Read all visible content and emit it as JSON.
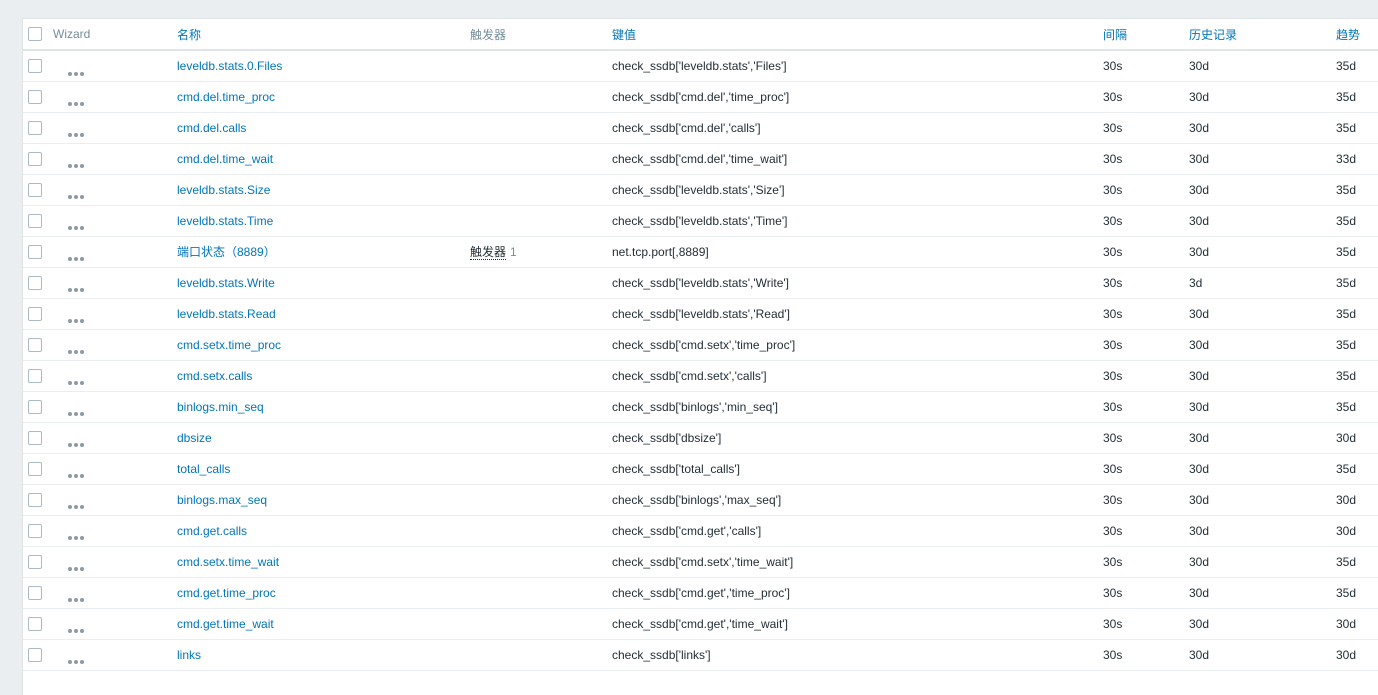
{
  "headers": {
    "wizard": "Wizard",
    "name": "名称",
    "triggers": "触发器",
    "key": "键值",
    "interval": "间隔",
    "history": "历史记录",
    "trends": "趋势"
  },
  "rows": [
    {
      "name": "leveldb.stats.0.Files",
      "trigger": "",
      "trigger_count": "",
      "key": "check_ssdb['leveldb.stats','Files']",
      "interval": "30s",
      "history": "30d",
      "trends": "35d"
    },
    {
      "name": "cmd.del.time_proc",
      "trigger": "",
      "trigger_count": "",
      "key": "check_ssdb['cmd.del','time_proc']",
      "interval": "30s",
      "history": "30d",
      "trends": "35d"
    },
    {
      "name": "cmd.del.calls",
      "trigger": "",
      "trigger_count": "",
      "key": "check_ssdb['cmd.del','calls']",
      "interval": "30s",
      "history": "30d",
      "trends": "35d"
    },
    {
      "name": "cmd.del.time_wait",
      "trigger": "",
      "trigger_count": "",
      "key": "check_ssdb['cmd.del','time_wait']",
      "interval": "30s",
      "history": "30d",
      "trends": "33d"
    },
    {
      "name": "leveldb.stats.Size",
      "trigger": "",
      "trigger_count": "",
      "key": "check_ssdb['leveldb.stats','Size']",
      "interval": "30s",
      "history": "30d",
      "trends": "35d"
    },
    {
      "name": "leveldb.stats.Time",
      "trigger": "",
      "trigger_count": "",
      "key": "check_ssdb['leveldb.stats','Time']",
      "interval": "30s",
      "history": "30d",
      "trends": "35d"
    },
    {
      "name": "端口状态（8889）",
      "trigger": "触发器",
      "trigger_count": "1",
      "key": "net.tcp.port[,8889]",
      "interval": "30s",
      "history": "30d",
      "trends": "35d"
    },
    {
      "name": "leveldb.stats.Write",
      "trigger": "",
      "trigger_count": "",
      "key": "check_ssdb['leveldb.stats','Write']",
      "interval": "30s",
      "history": "3d",
      "trends": "35d"
    },
    {
      "name": "leveldb.stats.Read",
      "trigger": "",
      "trigger_count": "",
      "key": "check_ssdb['leveldb.stats','Read']",
      "interval": "30s",
      "history": "30d",
      "trends": "35d"
    },
    {
      "name": "cmd.setx.time_proc",
      "trigger": "",
      "trigger_count": "",
      "key": "check_ssdb['cmd.setx','time_proc']",
      "interval": "30s",
      "history": "30d",
      "trends": "35d"
    },
    {
      "name": "cmd.setx.calls",
      "trigger": "",
      "trigger_count": "",
      "key": "check_ssdb['cmd.setx','calls']",
      "interval": "30s",
      "history": "30d",
      "trends": "35d"
    },
    {
      "name": "binlogs.min_seq",
      "trigger": "",
      "trigger_count": "",
      "key": "check_ssdb['binlogs','min_seq']",
      "interval": "30s",
      "history": "30d",
      "trends": "35d"
    },
    {
      "name": "dbsize",
      "trigger": "",
      "trigger_count": "",
      "key": "check_ssdb['dbsize']",
      "interval": "30s",
      "history": "30d",
      "trends": "30d"
    },
    {
      "name": "total_calls",
      "trigger": "",
      "trigger_count": "",
      "key": "check_ssdb['total_calls']",
      "interval": "30s",
      "history": "30d",
      "trends": "35d"
    },
    {
      "name": "binlogs.max_seq",
      "trigger": "",
      "trigger_count": "",
      "key": "check_ssdb['binlogs','max_seq']",
      "interval": "30s",
      "history": "30d",
      "trends": "30d"
    },
    {
      "name": "cmd.get.calls",
      "trigger": "",
      "trigger_count": "",
      "key": "check_ssdb['cmd.get','calls']",
      "interval": "30s",
      "history": "30d",
      "trends": "30d"
    },
    {
      "name": "cmd.setx.time_wait",
      "trigger": "",
      "trigger_count": "",
      "key": "check_ssdb['cmd.setx','time_wait']",
      "interval": "30s",
      "history": "30d",
      "trends": "35d"
    },
    {
      "name": "cmd.get.time_proc",
      "trigger": "",
      "trigger_count": "",
      "key": "check_ssdb['cmd.get','time_proc']",
      "interval": "30s",
      "history": "30d",
      "trends": "35d"
    },
    {
      "name": "cmd.get.time_wait",
      "trigger": "",
      "trigger_count": "",
      "key": "check_ssdb['cmd.get','time_wait']",
      "interval": "30s",
      "history": "30d",
      "trends": "30d"
    },
    {
      "name": "links",
      "trigger": "",
      "trigger_count": "",
      "key": "check_ssdb['links']",
      "interval": "30s",
      "history": "30d",
      "trends": "30d"
    }
  ],
  "colors": {
    "link": "#0275b8",
    "header_muted": "#768d99",
    "text": "#1f2c33",
    "background": "#ebeef0"
  },
  "icons": {
    "row_menu": "more-dots-icon",
    "select": "checkbox"
  }
}
